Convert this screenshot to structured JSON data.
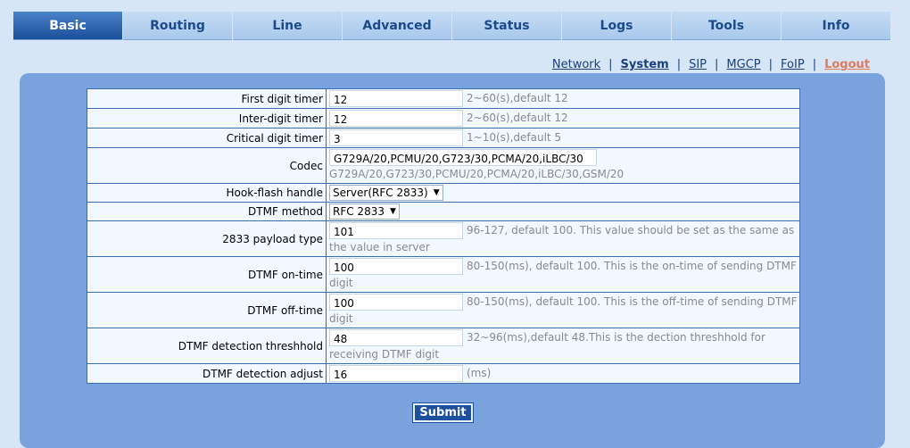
{
  "tabs": [
    {
      "label": "Basic",
      "active": true
    },
    {
      "label": "Routing"
    },
    {
      "label": "Line"
    },
    {
      "label": "Advanced"
    },
    {
      "label": "Status"
    },
    {
      "label": "Logs"
    },
    {
      "label": "Tools"
    },
    {
      "label": "Info"
    }
  ],
  "subnav": {
    "network": "Network",
    "system": "System",
    "sip": "SIP",
    "mgcp": "MGCP",
    "foip": "FoIP",
    "logout": "Logout",
    "separator": "|"
  },
  "rows": {
    "first_digit_timer": {
      "label": "First digit timer",
      "value": "12",
      "hint": "2~60(s),default 12"
    },
    "inter_digit_timer": {
      "label": "Inter-digit timer",
      "value": "12",
      "hint": "2~60(s),default 12"
    },
    "critical_digit_timer": {
      "label": "Critical digit timer",
      "value": "3",
      "hint": "1~10(s),default 5"
    },
    "codec": {
      "label": "Codec",
      "value": "G729A/20,PCMU/20,G723/30,PCMA/20,iLBC/30",
      "hint": "G729A/20,G723/30,PCMU/20,PCMA/20,iLBC/30,GSM/20"
    },
    "hook_flash": {
      "label": "Hook-flash handle",
      "value": "Server(RFC 2833)"
    },
    "dtmf_method": {
      "label": "DTMF method",
      "value": "RFC 2833"
    },
    "payload_type": {
      "label": "2833 payload type",
      "value": "101",
      "hint": "96-127, default 100. This value should be set as the same as the value in server"
    },
    "dtmf_on_time": {
      "label": "DTMF on-time",
      "value": "100",
      "hint": "80-150(ms), default 100. This is the on-time of sending DTMF digit"
    },
    "dtmf_off_time": {
      "label": "DTMF off-time",
      "value": "100",
      "hint": "80-150(ms), default 100. This is the off-time of sending DTMF digit"
    },
    "dtmf_threshold": {
      "label": "DTMF detection threshhold",
      "value": "48",
      "hint": "32~96(ms),default 48.This is the dection threshhold for receiving DTMF digit"
    },
    "dtmf_adjust": {
      "label": "DTMF detection adjust",
      "value": "16",
      "hint": "(ms)"
    }
  },
  "submit_label": "Submit",
  "colors": {
    "accent": "#1c4f9c",
    "panel": "#7aa3dd",
    "background": "#d6e6f7",
    "logout": "#e07a5f"
  }
}
